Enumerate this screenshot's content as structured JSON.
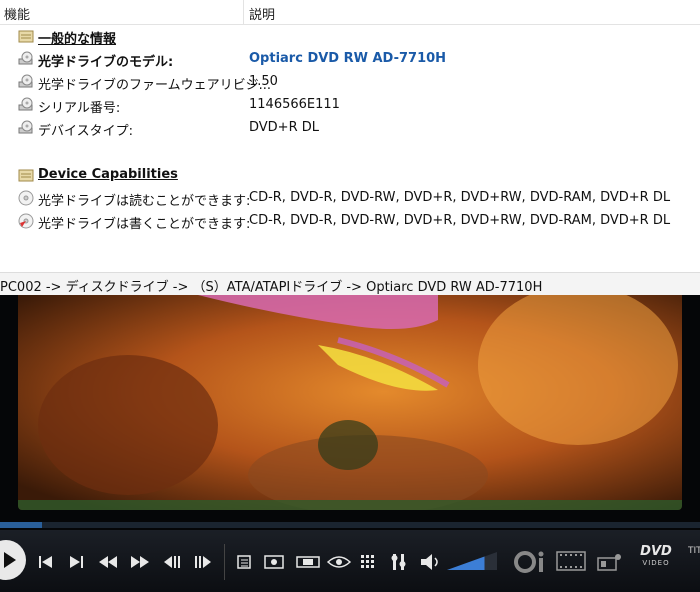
{
  "columns": {
    "feature": "機能",
    "description": "説明"
  },
  "sections": [
    {
      "title": "一般的な情報",
      "rows": [
        {
          "label": "光学ドライブのモデル:",
          "value": "Optiarc DVD RW AD-7710H",
          "bold": true,
          "link": true
        },
        {
          "label": "光学ドライブのファームウェアリビジ...",
          "value": "1.50"
        },
        {
          "label": "シリアル番号:",
          "value": "1146566E111"
        },
        {
          "label": "デバイスタイプ:",
          "value": "DVD+R DL"
        }
      ]
    },
    {
      "title": "Device Capabilities",
      "rows": [
        {
          "label": "光学ドライブは読むことができます:",
          "value": "CD-R, DVD-R, DVD-RW, DVD+R, DVD+RW, DVD-RAM, DVD+R DL"
        },
        {
          "label": "光学ドライブは書くことができます:",
          "value": "CD-R, DVD-R, DVD-RW, DVD+R, DVD+RW, DVD-RAM, DVD+R DL"
        }
      ]
    }
  ],
  "breadcrumb": "PC002 -> ディスクドライブ -> （S）ATA/ATAPIドライブ -> Optiarc DVD RW AD-7710H",
  "player": {
    "seek_progress": 0.06,
    "volume_level": 0.75,
    "dvd_badge": "DVD",
    "dvd_sub": "VIDEO",
    "title_partial": "TIT"
  },
  "colors": {
    "link": "#1a5aa8",
    "seek_fill": "#2a5f9a",
    "volume": "#3c7ed6"
  }
}
